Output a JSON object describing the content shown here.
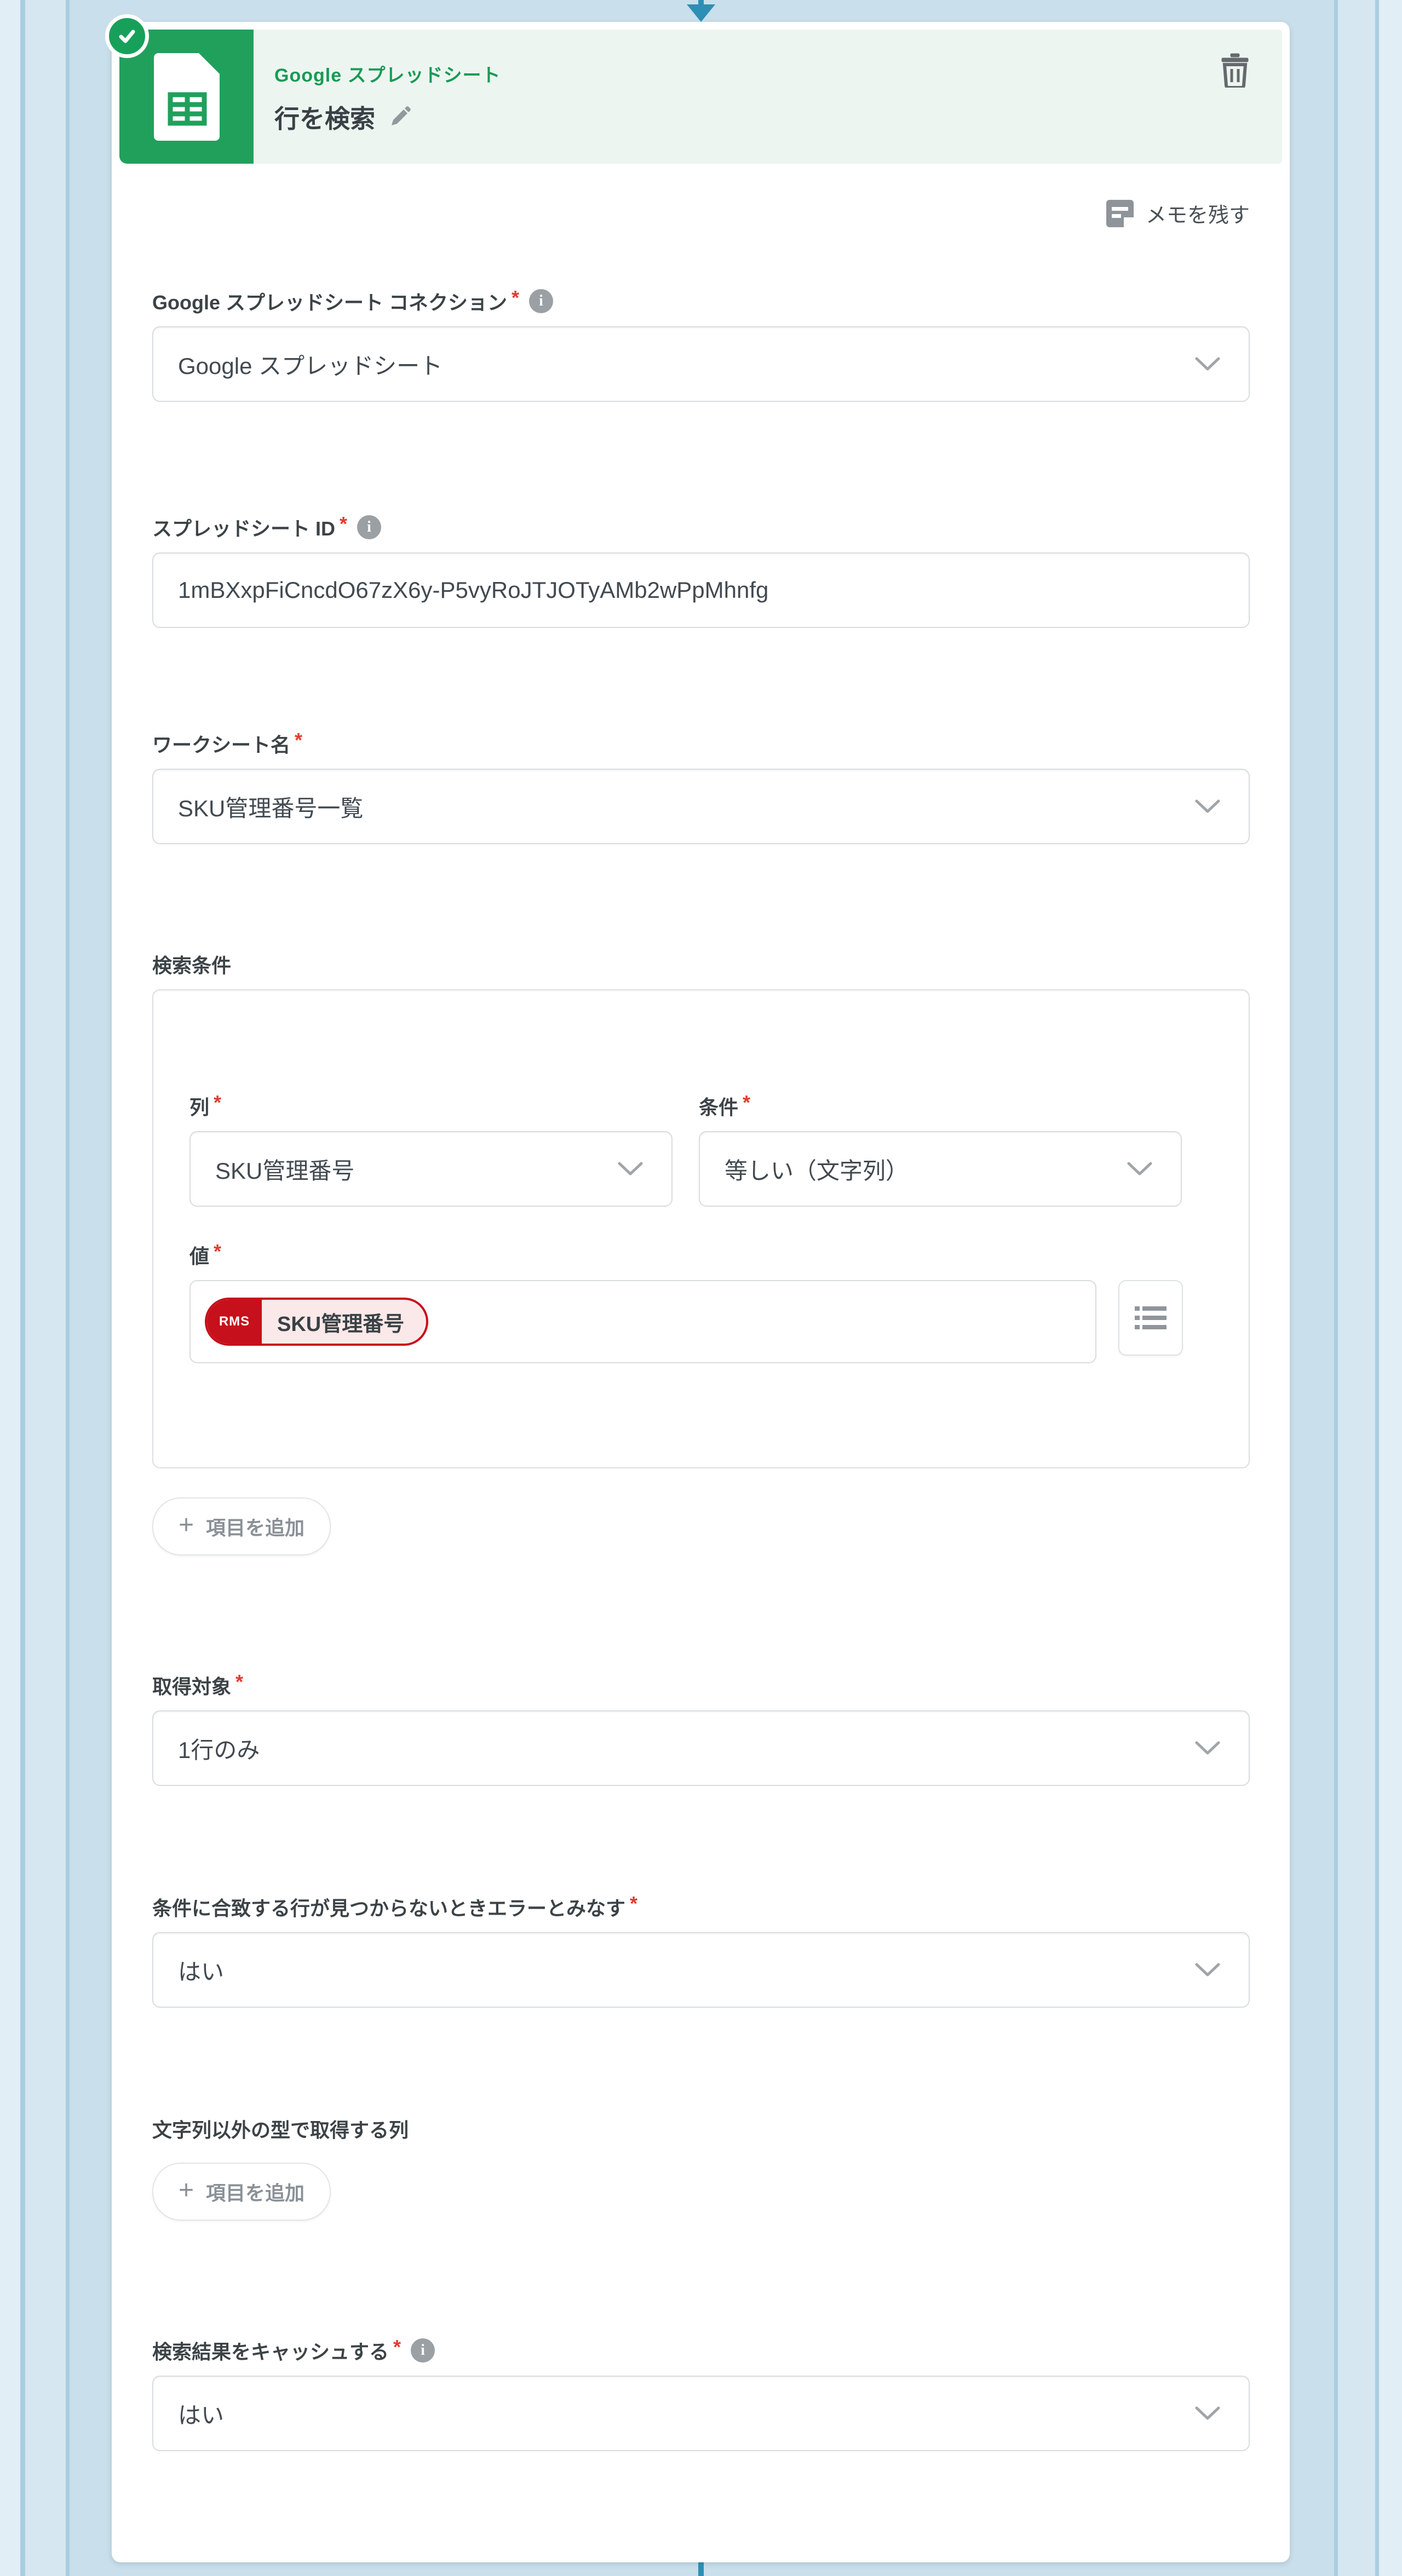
{
  "colors": {
    "accent_green": "#21a05c",
    "header_bg": "#edf5f0",
    "connector_teal": "#2d8fb4",
    "tag_red": "#c6101b",
    "required_red": "#e23b30"
  },
  "marks": {
    "required": "*",
    "info": "i",
    "plus": "+"
  },
  "header": {
    "app_name": "Google スプレッドシート",
    "title": "行を検索"
  },
  "memo": {
    "label": "メモを残す"
  },
  "fields": {
    "connection": {
      "label": "Google スプレッドシート コネクション",
      "value": "Google スプレッドシート"
    },
    "spreadsheet_id": {
      "label": "スプレッドシート ID",
      "value": "1mBXxpFiCncdO67zX6y-P5vyRoJTJOTyAMb2wPpMhnfg"
    },
    "worksheet": {
      "label": "ワークシート名",
      "value": "SKU管理番号一覧"
    },
    "search_conditions": {
      "label": "検索条件",
      "column": {
        "label": "列",
        "value": "SKU管理番号"
      },
      "operator": {
        "label": "条件",
        "value": "等しい（文字列）"
      },
      "value": {
        "label": "値",
        "tag_source": "RMS",
        "tag_text": "SKU管理番号"
      },
      "add_button_label": "項目を追加"
    },
    "target": {
      "label": "取得対象",
      "value": "1行のみ"
    },
    "error_if_not_found": {
      "label": "条件に合致する行が見つからないときエラーとみなす",
      "value": "はい"
    },
    "non_string_columns": {
      "label": "文字列以外の型で取得する列",
      "add_button_label": "項目を追加"
    },
    "cache_results": {
      "label": "検索結果をキャッシュする",
      "value": "はい"
    }
  }
}
